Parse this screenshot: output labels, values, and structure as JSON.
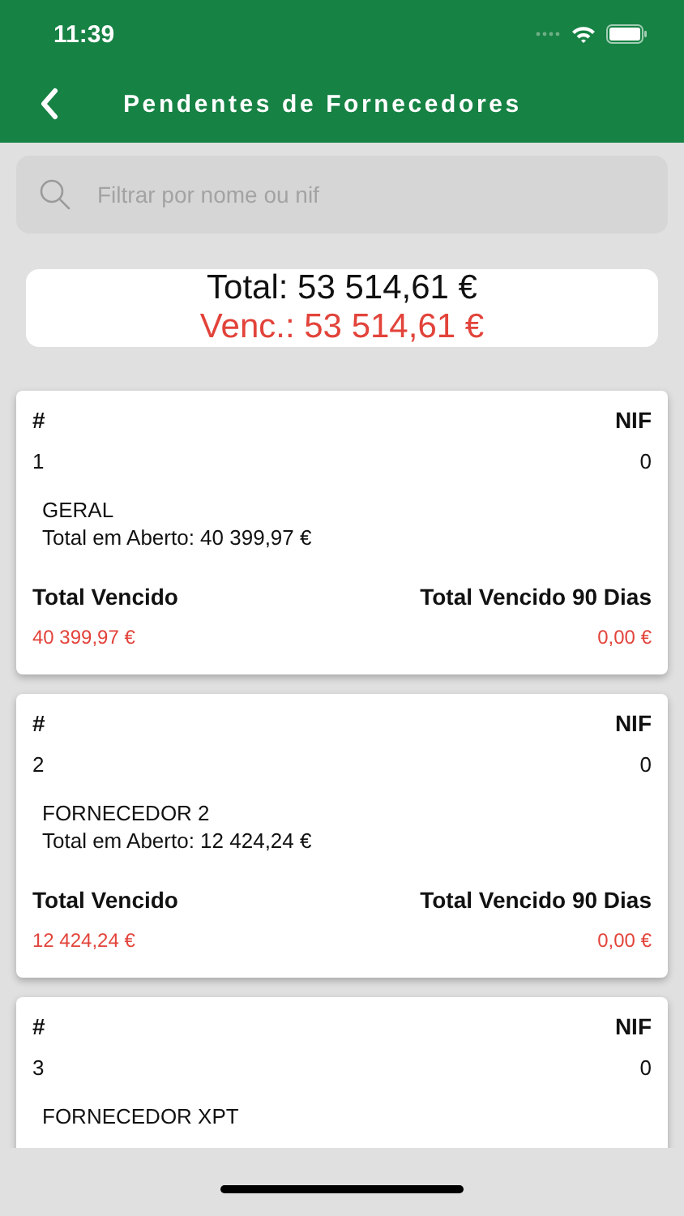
{
  "status_bar": {
    "time": "11:39"
  },
  "header": {
    "title": "Pendentes de Fornecedores"
  },
  "search": {
    "placeholder": "Filtrar por nome ou nif"
  },
  "summary": {
    "total": "Total: 53 514,61 €",
    "overdue": "Venc.: 53 514,61 €"
  },
  "suppliers": [
    {
      "id_label": "#",
      "nif_label": "NIF",
      "id": "1",
      "nif": "0",
      "name": "GERAL",
      "open_total": "Total em Aberto: 40 399,97 €",
      "overdue_label": "Total Vencido",
      "overdue_90_label": "Total Vencido 90 Dias",
      "overdue": "40 399,97 €",
      "overdue_90": "0,00 €"
    },
    {
      "id_label": "#",
      "nif_label": "NIF",
      "id": "2",
      "nif": "0",
      "name": "FORNECEDOR 2",
      "open_total": "Total em Aberto: 12 424,24 €",
      "overdue_label": "Total Vencido",
      "overdue_90_label": "Total Vencido 90 Dias",
      "overdue": "12 424,24 €",
      "overdue_90": "0,00 €"
    },
    {
      "id_label": "#",
      "nif_label": "NIF",
      "id": "3",
      "nif": "0",
      "name": "FORNECEDOR XPT"
    }
  ]
}
